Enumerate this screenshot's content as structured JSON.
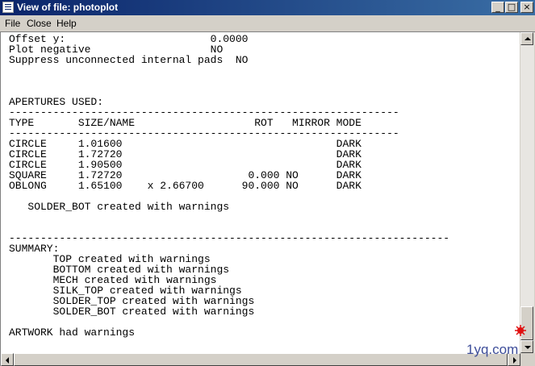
{
  "window": {
    "title": "View of file: photoplot",
    "buttons": {
      "minimize": "_",
      "maximize": "□",
      "close": "×"
    }
  },
  "menu": [
    {
      "label": "File"
    },
    {
      "label": "Close"
    },
    {
      "label": "Help"
    }
  ],
  "report_lines": [
    "Offset y:                       0.0000",
    "Plot negative                   NO",
    "Suppress unconnected internal pads  NO",
    "",
    "",
    "",
    "APERTURES USED:",
    "--------------------------------------------------------------",
    "TYPE       SIZE/NAME                   ROT   MIRROR MODE",
    "--------------------------------------------------------------",
    "CIRCLE     1.01600                                  DARK",
    "CIRCLE     1.72720                                  DARK",
    "CIRCLE     1.90500                                  DARK",
    "SQUARE     1.72720                    0.000 NO      DARK",
    "OBLONG     1.65100    x 2.66700      90.000 NO      DARK",
    "",
    "   SOLDER_BOT created with warnings",
    "",
    "",
    "----------------------------------------------------------------------",
    "SUMMARY:",
    "       TOP created with warnings",
    "       BOTTOM created with warnings",
    "       MECH created with warnings",
    "       SILK_TOP created with warnings",
    "       SOLDER_TOP created with warnings",
    "       SOLDER_BOT created with warnings",
    "",
    "ARTWORK had warnings"
  ],
  "watermark": "1yq.com"
}
